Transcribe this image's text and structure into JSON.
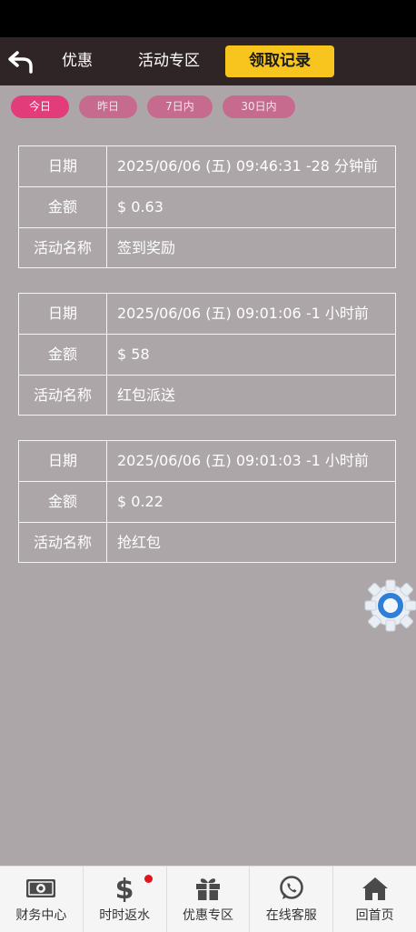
{
  "header": {
    "tabs": [
      {
        "label": "优惠"
      },
      {
        "label": "活动专区"
      },
      {
        "label": "领取记录"
      }
    ]
  },
  "filters": [
    {
      "label": "今日",
      "active": true
    },
    {
      "label": "昨日"
    },
    {
      "label": "7日内"
    },
    {
      "label": "30日内"
    }
  ],
  "records": [
    {
      "date_label": "日期",
      "date": "2025/06/06 (五) 09:46:31 -28 分钟前",
      "amount_label": "金额",
      "amount": "$ 0.63",
      "name_label": "活动名称",
      "name": "签到奖励"
    },
    {
      "date_label": "日期",
      "date": "2025/06/06 (五) 09:01:06 -1 小时前",
      "amount_label": "金额",
      "amount": "$ 58",
      "name_label": "活动名称",
      "name": "红包派送"
    },
    {
      "date_label": "日期",
      "date": "2025/06/06 (五) 09:01:03 -1 小时前",
      "amount_label": "金额",
      "amount": "$ 0.22",
      "name_label": "活动名称",
      "name": "抢红包"
    }
  ],
  "bottom_nav": [
    {
      "label": "财务中心",
      "icon": "cash-icon"
    },
    {
      "label": "时时返水",
      "icon": "dollar-icon",
      "badge": true
    },
    {
      "label": "优惠专区",
      "icon": "gift-icon"
    },
    {
      "label": "在线客服",
      "icon": "whatsapp-icon"
    },
    {
      "label": "回首页",
      "icon": "home-icon"
    }
  ],
  "colors": {
    "background": "#aca6a8",
    "header": "#2f2526",
    "active_tab": "#f7c51e",
    "active_chip": "#e23c7b",
    "chip": "#c76b8e",
    "badge": "#e0141b"
  }
}
